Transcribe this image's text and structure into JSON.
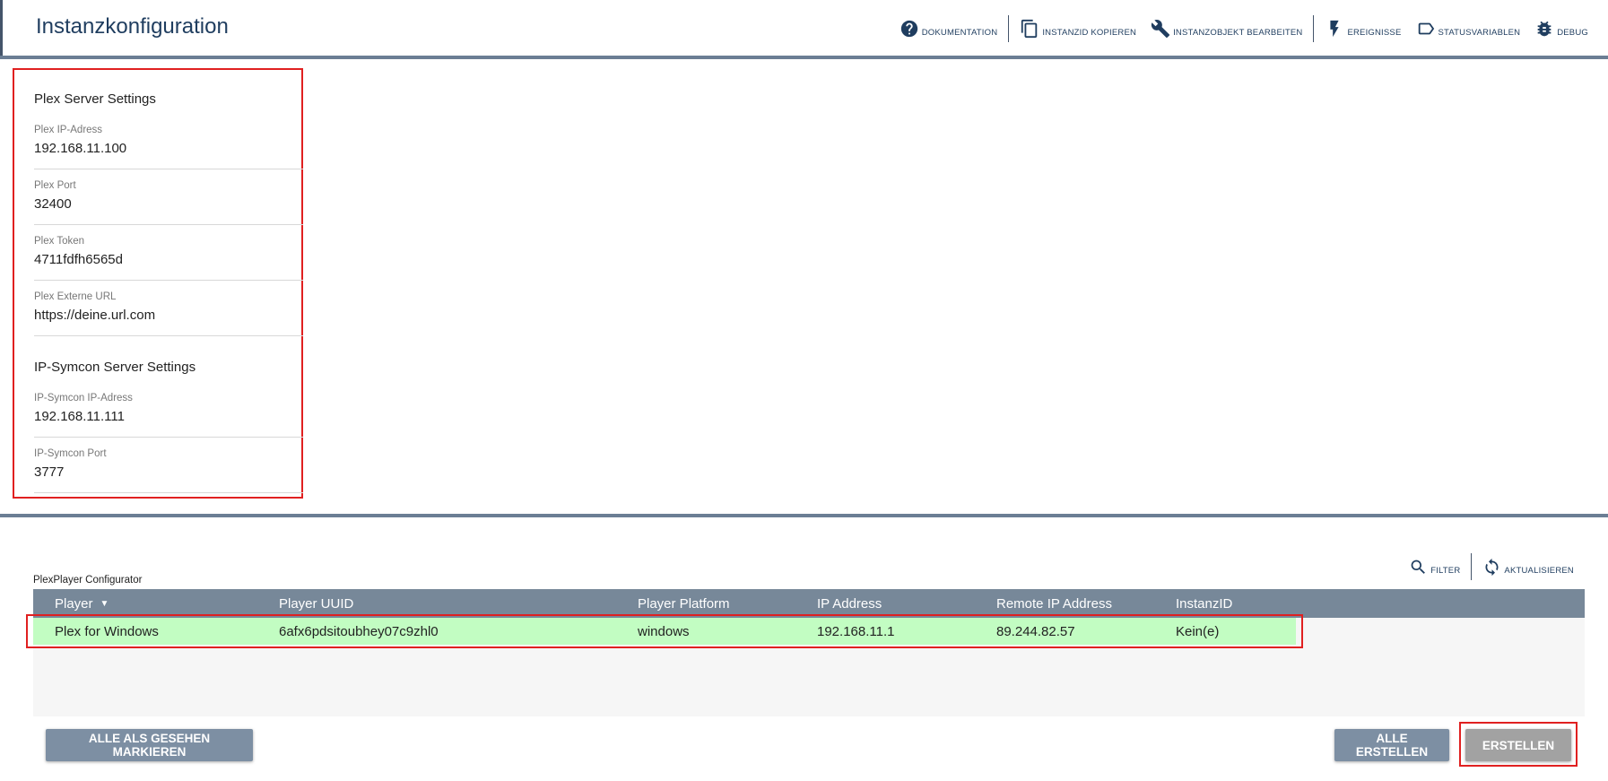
{
  "header": {
    "title": "Instanzkonfiguration",
    "toolbar": [
      {
        "label": "Dokumentation",
        "icon": "help-circle-icon"
      },
      {
        "label": "InstanzID kopieren",
        "icon": "copy-icon"
      },
      {
        "label": "Instanzobjekt bearbeiten",
        "icon": "wrench-icon"
      },
      {
        "label": "Ereignisse",
        "icon": "lightning-icon"
      },
      {
        "label": "Statusvariablen",
        "icon": "tag-icon"
      },
      {
        "label": "Debug",
        "icon": "bug-icon"
      }
    ]
  },
  "form": {
    "plex_section_title": "Plex Server Settings",
    "plex_ip": {
      "label": "Plex IP-Adress",
      "value": "192.168.11.100"
    },
    "plex_port": {
      "label": "Plex Port",
      "value": "32400"
    },
    "plex_token": {
      "label": "Plex Token",
      "value": "4711fdfh6565d"
    },
    "plex_external_url": {
      "label": "Plex Externe URL",
      "value": "https://deine.url.com"
    },
    "symcon_section_title": "IP-Symcon Server Settings",
    "symcon_ip": {
      "label": "IP-Symcon IP-Adress",
      "value": "192.168.11.111"
    },
    "symcon_port": {
      "label": "IP-Symcon Port",
      "value": "3777"
    }
  },
  "configurator": {
    "label": "PlexPlayer Configurator",
    "toolbar": {
      "filter_label": "Filter",
      "refresh_label": "Aktualisieren"
    },
    "columns": [
      "Player",
      "Player UUID",
      "Player Platform",
      "IP Address",
      "Remote IP Address",
      "InstanzID"
    ],
    "sorted_column": "Player",
    "rows": [
      {
        "player": "Plex for Windows",
        "uuid": "6afx6pdsitoubhey07c9zhl0",
        "platform": "windows",
        "ip": "192.168.11.1",
        "remote_ip": "89.244.82.57",
        "instance_id": "Kein(e)"
      }
    ]
  },
  "actions": {
    "mark_all_seen": "Alle als gesehen markieren",
    "create_all": "Alle erstellen",
    "create": "Erstellen"
  },
  "colors": {
    "title": "#1f3d5f",
    "divider": "#6b7e94",
    "table_header": "#778899",
    "row_highlight": "#c2fdc2",
    "annotation": "#e02020",
    "button_primary": "#7d8fa3",
    "button_disabled": "#a2a2a2"
  }
}
